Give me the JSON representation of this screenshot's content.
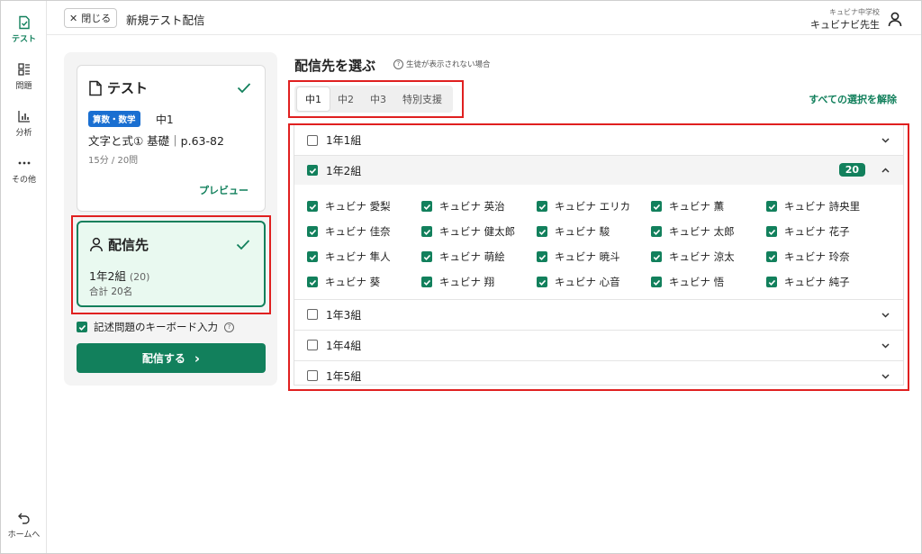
{
  "sidebar": {
    "items": [
      {
        "label": "テスト",
        "icon": "test-doc-icon",
        "active": true
      },
      {
        "label": "問題",
        "icon": "question-list-icon"
      },
      {
        "label": "分析",
        "icon": "bar-chart-icon"
      },
      {
        "label": "その他",
        "icon": "more-dots-icon"
      }
    ],
    "home_label": "ホームへ"
  },
  "header": {
    "close_label": "閉じる",
    "title": "新規テスト配信",
    "school": "キュビナ中学校",
    "teacher": "キュビナビ先生"
  },
  "test_card": {
    "title": "テスト",
    "subject": "算数・数学",
    "grade": "中1",
    "unit": "文字と式① 基礎｜p.63-82",
    "meta": "15分 / 20問",
    "preview_label": "プレビュー"
  },
  "dest_card": {
    "title": "配信先",
    "class_label": "1年2組",
    "class_count": "(20)",
    "total": "合計 20名"
  },
  "keyboard_option": {
    "label": "記述問題のキーボード入力",
    "checked": true,
    "help": "?"
  },
  "deliver_button": {
    "label": "配信する",
    "arrow": "›"
  },
  "main": {
    "title": "配信先を選ぶ",
    "help_text": "生徒が表示されない場合",
    "clear_all": "すべての選択を解除",
    "grade_tabs": [
      "中1",
      "中2",
      "中3",
      "特別支援"
    ],
    "active_tab": "中1",
    "classes": [
      {
        "name": "1年1組",
        "checked": false
      },
      {
        "name": "1年2組",
        "checked": true,
        "count": "20"
      },
      {
        "name": "1年3組",
        "checked": false
      },
      {
        "name": "1年4組",
        "checked": false
      },
      {
        "name": "1年5組",
        "checked": false
      }
    ],
    "students": [
      "キュビナ 愛梨",
      "キュビナ 英治",
      "キュビナ エリカ",
      "キュビナ 薫",
      "キュビナ 詩央里",
      "キュビナ 佳奈",
      "キュビナ 健太郎",
      "キュビナ 駿",
      "キュビナ 太郎",
      "キュビナ 花子",
      "キュビナ 隼人",
      "キュビナ 萌絵",
      "キュビナ 暁斗",
      "キュビナ 涼太",
      "キュビナ 玲奈",
      "キュビナ 葵",
      "キュビナ 翔",
      "キュビナ 心音",
      "キュビナ 悟",
      "キュビナ 純子"
    ]
  },
  "colors": {
    "accent": "#12805c",
    "badge_blue": "#1a6fd1",
    "highlight": "#e02020"
  }
}
